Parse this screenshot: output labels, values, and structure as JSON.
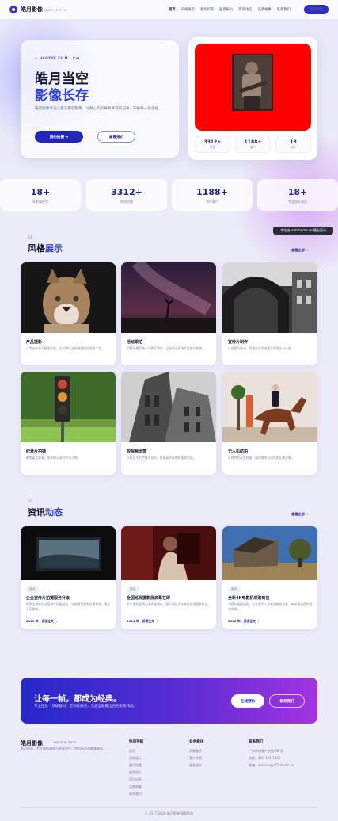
{
  "nav": {
    "brand": "皓月影像",
    "brand_sub": "HAOYUE FILM",
    "items": [
      "首页",
      "风格展示",
      "客片欣赏",
      "服务报价",
      "资讯动态",
      "品牌故事",
      "联系我们"
    ],
    "cta": "在线预约"
  },
  "hero": {
    "eyebrow": "✦ HAOYUE FILM · 广州",
    "title_line1": "皓月当空",
    "title_line2": "影像长存",
    "desc": "皓月影像专注儿童与家庭影像，以耐心的引导和真诚的记录，守护每一份美好。",
    "btn_primary": "预约拍摄 →",
    "btn_secondary": "查看报价",
    "mini_stats": [
      {
        "value": "3312+",
        "label": "作品"
      },
      {
        "value": "1188+",
        "label": "客户"
      },
      {
        "value": "18",
        "label": "团队"
      }
    ]
  },
  "stats": [
    {
      "value": "18+",
      "label": "年影像经验"
    },
    {
      "value": "3312+",
      "label": "原创拍摄"
    },
    {
      "value": "1188+",
      "label": "合作客户"
    },
    {
      "value": "18+",
      "label": "专业团队成员"
    }
  ],
  "badge": "本站由 webtheme.cn 模板驱动",
  "styles": {
    "num": "01",
    "title_plain": "风格",
    "title_accent": "展示",
    "see_all": "查看全部 →",
    "cards": [
      {
        "title": "产品摄影",
        "desc": "以专业布光与精准构图，为品牌打造质感细腻的视觉广告。"
      },
      {
        "title": "活动跟拍",
        "desc": "用镜头捕捉每一个真实瞬间，记录活动现场的温度与故事。"
      },
      {
        "title": "宣传片制作",
        "desc": "以创意为核心，用镜头语言讲述品牌理念与价值。"
      },
      {
        "title": "纪录片拍摄",
        "desc": "聚焦真实故事，用影像记录时代与人物。"
      },
      {
        "title": "短视频运营",
        "desc": "以社交平台传播为导向，打造高质量的短视频内容。"
      },
      {
        "title": "无人机航拍",
        "desc": "以独特的高空视角，展现城市与自然的壮美全景。"
      }
    ]
  },
  "news": {
    "num": "02",
    "title_plain": "资讯",
    "title_accent": "动态",
    "see_all": "查看全部 →",
    "cards": [
      {
        "tag": "资讯",
        "title": "企业宣传片拍摄服务升级",
        "desc": "提供全流程企业宣传片拍摄服务，从前期策划到后期剪辑，满足不同需求。",
        "meta": "2026 年  ·  阅读全文 →"
      },
      {
        "tag": "资讯",
        "title": "全国巡展摄影展启幕在即",
        "desc": "本年度巡展将走进多座城市，展示团队近年来的优秀摄影作品。",
        "meta": "2024 年  ·  阅读全文 →"
      },
      {
        "tag": "资讯",
        "title": "全新4K电影机采购到位",
        "desc": "为提升拍摄画质，工作室引入全新电影级设备，带来更出色的视觉效果。",
        "meta": "2022 年  ·  阅读全文 →"
      }
    ]
  },
  "cta": {
    "title": "让每一帧，都成为经典。",
    "desc": "专业团队 · 顶级器材 · 定制化服务，为您呈献最出色的影像作品。",
    "btn_primary": "在线预约",
    "btn_secondary": "联系我们"
  },
  "footer": {
    "brand": "皓月影像",
    "brand_sub": "HAOYUE FILM",
    "desc": "皓月影像，专注摄影摄像与影视创作，提供高品质影像服务。",
    "col1": {
      "title": "快速导航",
      "links": [
        "首页",
        "风格展示",
        "客片欣赏",
        "服务报价",
        "资讯动态",
        "品牌故事",
        "联系我们"
      ]
    },
    "col2": {
      "title": "业务板块",
      "links": [
        "风格展示",
        "客片欣赏",
        "服务报价"
      ]
    },
    "col3": {
      "title": "联系我们",
      "links": [
        "广州市创意产业园 88 号",
        "电话：400-124-1880",
        "邮箱：service@p25.studio.cn"
      ]
    },
    "copyright": "© 2017-2026 皓月影像 版权所有"
  },
  "colors": {
    "accent": "#2c3dd6",
    "primary_button": "#2227b8",
    "hero_panel": "#ff0000",
    "badge_bg": "#2a2d38"
  }
}
